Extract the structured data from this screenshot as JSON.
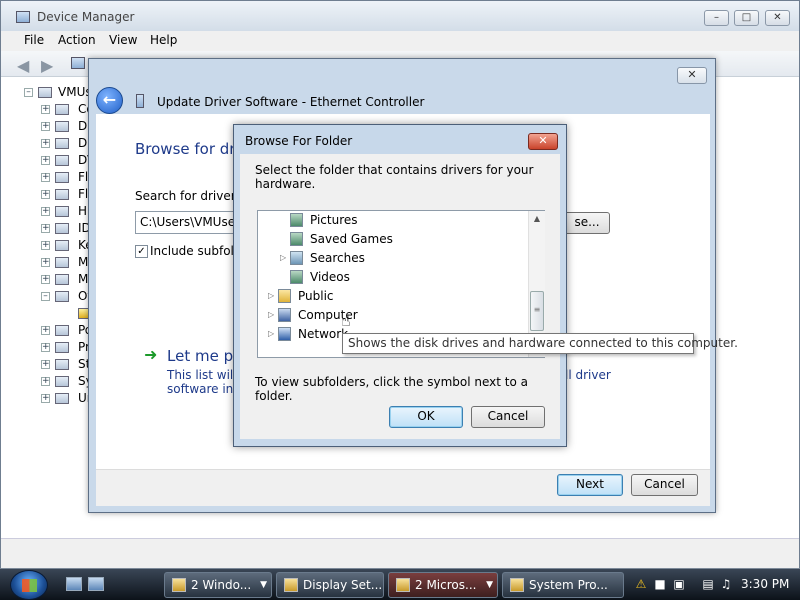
{
  "device_manager": {
    "title": "Device Manager",
    "menu": [
      "File",
      "Action",
      "View",
      "Help"
    ],
    "tree_root": "VMUs",
    "tree_items": [
      "Co",
      "Di",
      "Di",
      "DV",
      "Fl",
      "Fl",
      "Hu",
      "ID",
      "Ke",
      "Mi",
      "M",
      "Ot",
      "",
      "Po",
      "Pr",
      "St",
      "Sy",
      "Ur"
    ]
  },
  "update_dialog": {
    "title": "Update Driver Software - Ethernet Controller",
    "heading": "Browse for dri",
    "search_label": "Search for driver so",
    "path_value": "C:\\Users\\VMUser\\",
    "browse_button": "se...",
    "include_subfolders": "Include subfold",
    "include_checked": true,
    "let_me_pick": "Let me pi",
    "desc_line1": "This list will s",
    "desc_line2": "software in t",
    "desc_right": "ll driver",
    "next_button": "Next",
    "cancel_button": "Cancel"
  },
  "browse_dialog": {
    "title": "Browse For Folder",
    "instruction": "Select the folder that contains drivers for your hardware.",
    "folders": [
      {
        "label": "Pictures",
        "level": 2,
        "expandable": false
      },
      {
        "label": "Saved Games",
        "level": 2,
        "expandable": false
      },
      {
        "label": "Searches",
        "level": 2,
        "expandable": true
      },
      {
        "label": "Videos",
        "level": 2,
        "expandable": false
      },
      {
        "label": "Public",
        "level": 1,
        "expandable": true
      },
      {
        "label": "Computer",
        "level": 1,
        "expandable": true
      },
      {
        "label": "Network",
        "level": 1,
        "expandable": true
      }
    ],
    "tooltip": "Shows the disk drives and hardware connected to this computer.",
    "hint": "To view subfolders, click the symbol next to a folder.",
    "ok_button": "OK",
    "cancel_button": "Cancel"
  },
  "taskbar": {
    "buttons": [
      {
        "label": "2 Windo...",
        "has_dropdown": true,
        "active": false
      },
      {
        "label": "Display Set...",
        "has_dropdown": false,
        "active": false
      },
      {
        "label": "2 Micros...",
        "has_dropdown": true,
        "active": true
      },
      {
        "label": "System Pro...",
        "has_dropdown": false,
        "active": false
      }
    ],
    "clock": "3:30 PM"
  }
}
